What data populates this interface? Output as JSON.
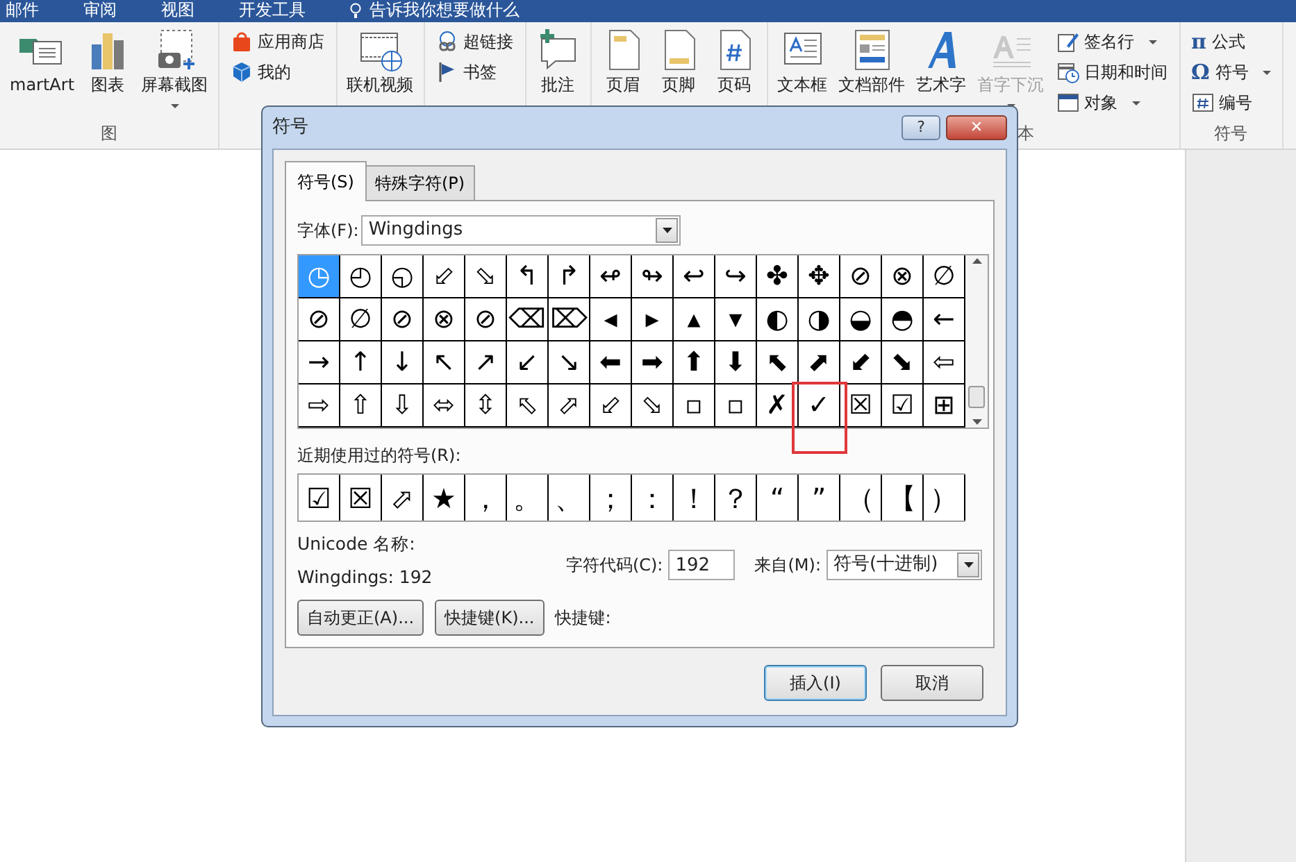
{
  "menu_tabs": [
    "邮件",
    "审阅",
    "视图",
    "开发工具"
  ],
  "tell_me": "告诉我你想要做什么",
  "ribbon": {
    "groups": [
      {
        "label": "图",
        "items": [
          {
            "label": "martArt",
            "kind": "large",
            "dropdown": false,
            "disabled": false
          },
          {
            "label": "图表",
            "kind": "large",
            "dropdown": false,
            "disabled": false
          },
          {
            "label": "屏幕截图",
            "kind": "large",
            "dropdown": true,
            "disabled": false
          }
        ]
      },
      {
        "items": [
          {
            "label": "应用商店",
            "kind": "small",
            "dropdown": false,
            "disabled": false
          },
          {
            "label": "我的",
            "kind": "small",
            "dropdown": false,
            "disabled": false
          }
        ]
      },
      {
        "items": [
          {
            "label": "联机视频",
            "kind": "large",
            "dropdown": false,
            "disabled": false
          }
        ]
      },
      {
        "items": [
          {
            "label": "超链接",
            "kind": "small",
            "dropdown": false,
            "disabled": false
          },
          {
            "label": "书签",
            "kind": "small",
            "dropdown": false,
            "disabled": false
          }
        ]
      },
      {
        "items": [
          {
            "label": "批注",
            "kind": "large",
            "dropdown": false,
            "disabled": false
          }
        ]
      },
      {
        "items": [
          {
            "label": "页眉",
            "kind": "large",
            "dropdown": false,
            "disabled": false
          },
          {
            "label": "页脚",
            "kind": "large",
            "dropdown": false,
            "disabled": false
          },
          {
            "label": "页码",
            "kind": "large",
            "dropdown": false,
            "disabled": false
          }
        ]
      },
      {
        "label": "本",
        "items": [
          {
            "label": "文本框",
            "kind": "large",
            "dropdown": false,
            "disabled": false
          },
          {
            "label": "文档部件",
            "kind": "large",
            "dropdown": false,
            "disabled": false
          },
          {
            "label": "艺术字",
            "kind": "large",
            "dropdown": false,
            "disabled": false
          },
          {
            "label": "首字下沉",
            "kind": "large",
            "dropdown": true,
            "disabled": true
          },
          {
            "label": "签名行",
            "kind": "small",
            "dropdown": true,
            "disabled": false
          },
          {
            "label": "日期和时间",
            "kind": "small",
            "dropdown": false,
            "disabled": false
          },
          {
            "label": "对象",
            "kind": "small",
            "dropdown": true,
            "disabled": false
          }
        ]
      },
      {
        "label": "符号",
        "items": [
          {
            "label": "公式",
            "kind": "small",
            "glyph": "π",
            "dropdown": false,
            "disabled": false
          },
          {
            "label": "符号",
            "kind": "small",
            "glyph": "Ω",
            "dropdown": true,
            "disabled": false
          },
          {
            "label": "编号",
            "kind": "small",
            "dropdown": false,
            "disabled": false
          }
        ]
      }
    ]
  },
  "dialog": {
    "title": "符号",
    "help_button": "?",
    "close_button": "✕",
    "tabs": [
      {
        "label": "符号(S)",
        "selected": true
      },
      {
        "label": "特殊字符(P)",
        "selected": false
      }
    ],
    "font_label": "字体(F):",
    "font_value": "Wingdings",
    "symbols": [
      {
        "glyph": "◷",
        "selected": true,
        "highlighted": false
      },
      {
        "glyph": "◴",
        "selected": false,
        "highlighted": false
      },
      {
        "glyph": "◵",
        "selected": false,
        "highlighted": false
      },
      {
        "glyph": "⬃",
        "selected": false,
        "highlighted": false
      },
      {
        "glyph": "⬂",
        "selected": false,
        "highlighted": false
      },
      {
        "glyph": "↰",
        "selected": false,
        "highlighted": false
      },
      {
        "glyph": "↱",
        "selected": false,
        "highlighted": false
      },
      {
        "glyph": "↫",
        "selected": false,
        "highlighted": false
      },
      {
        "glyph": "↬",
        "selected": false,
        "highlighted": false
      },
      {
        "glyph": "↩",
        "selected": false,
        "highlighted": false
      },
      {
        "glyph": "↪",
        "selected": false,
        "highlighted": false
      },
      {
        "glyph": "✤",
        "selected": false,
        "highlighted": false
      },
      {
        "glyph": "✥",
        "selected": false,
        "highlighted": false
      },
      {
        "glyph": "⊘",
        "selected": false,
        "highlighted": false
      },
      {
        "glyph": "⊗",
        "selected": false,
        "highlighted": false
      },
      {
        "glyph": "∅",
        "selected": false,
        "highlighted": false
      },
      {
        "glyph": "⊘",
        "selected": false,
        "highlighted": false
      },
      {
        "glyph": "∅",
        "selected": false,
        "highlighted": false
      },
      {
        "glyph": "⊘",
        "selected": false,
        "highlighted": false
      },
      {
        "glyph": "⊗",
        "selected": false,
        "highlighted": false
      },
      {
        "glyph": "⊘",
        "selected": false,
        "highlighted": false
      },
      {
        "glyph": "⌫",
        "selected": false,
        "highlighted": false
      },
      {
        "glyph": "⌦",
        "selected": false,
        "highlighted": false
      },
      {
        "glyph": "◂",
        "selected": false,
        "highlighted": false
      },
      {
        "glyph": "▸",
        "selected": false,
        "highlighted": false
      },
      {
        "glyph": "▴",
        "selected": false,
        "highlighted": false
      },
      {
        "glyph": "▾",
        "selected": false,
        "highlighted": false
      },
      {
        "glyph": "◐",
        "selected": false,
        "highlighted": false
      },
      {
        "glyph": "◑",
        "selected": false,
        "highlighted": false
      },
      {
        "glyph": "◒",
        "selected": false,
        "highlighted": false
      },
      {
        "glyph": "◓",
        "selected": false,
        "highlighted": false
      },
      {
        "glyph": "←",
        "selected": false,
        "highlighted": false
      },
      {
        "glyph": "→",
        "selected": false,
        "highlighted": false
      },
      {
        "glyph": "↑",
        "selected": false,
        "highlighted": false
      },
      {
        "glyph": "↓",
        "selected": false,
        "highlighted": false
      },
      {
        "glyph": "↖",
        "selected": false,
        "highlighted": false
      },
      {
        "glyph": "↗",
        "selected": false,
        "highlighted": false
      },
      {
        "glyph": "↙",
        "selected": false,
        "highlighted": false
      },
      {
        "glyph": "↘",
        "selected": false,
        "highlighted": false
      },
      {
        "glyph": "⬅",
        "selected": false,
        "highlighted": false
      },
      {
        "glyph": "➡",
        "selected": false,
        "highlighted": false
      },
      {
        "glyph": "⬆",
        "selected": false,
        "highlighted": false
      },
      {
        "glyph": "⬇",
        "selected": false,
        "highlighted": false
      },
      {
        "glyph": "⬉",
        "selected": false,
        "highlighted": false
      },
      {
        "glyph": "⬈",
        "selected": false,
        "highlighted": false
      },
      {
        "glyph": "⬋",
        "selected": false,
        "highlighted": false
      },
      {
        "glyph": "⬊",
        "selected": false,
        "highlighted": false
      },
      {
        "glyph": "⇦",
        "selected": false,
        "highlighted": false
      },
      {
        "glyph": "⇨",
        "selected": false,
        "highlighted": false
      },
      {
        "glyph": "⇧",
        "selected": false,
        "highlighted": false
      },
      {
        "glyph": "⇩",
        "selected": false,
        "highlighted": false
      },
      {
        "glyph": "⬄",
        "selected": false,
        "highlighted": false
      },
      {
        "glyph": "⇳",
        "selected": false,
        "highlighted": false
      },
      {
        "glyph": "⬁",
        "selected": false,
        "highlighted": false
      },
      {
        "glyph": "⬀",
        "selected": false,
        "highlighted": false
      },
      {
        "glyph": "⬃",
        "selected": false,
        "highlighted": false
      },
      {
        "glyph": "⬂",
        "selected": false,
        "highlighted": false
      },
      {
        "glyph": "▫",
        "selected": false,
        "highlighted": false
      },
      {
        "glyph": "▫",
        "selected": false,
        "highlighted": false
      },
      {
        "glyph": "✗",
        "selected": false,
        "highlighted": false
      },
      {
        "glyph": "✓",
        "selected": false,
        "highlighted": true
      },
      {
        "glyph": "☒",
        "selected": false,
        "highlighted": false
      },
      {
        "glyph": "☑",
        "selected": false,
        "highlighted": false
      },
      {
        "glyph": "⊞",
        "selected": false,
        "highlighted": false
      }
    ],
    "recent_label": "近期使用过的符号(R):",
    "recent": [
      "☑",
      "☒",
      "⬀",
      "★",
      "，",
      "。",
      "、",
      "；",
      "：",
      "！",
      "？",
      "“",
      "”",
      "（",
      "【",
      "）"
    ],
    "unicode_name_label": "Unicode 名称:",
    "unicode_name": "Wingdings: 192",
    "code_label": "字符代码(C):",
    "code_value": "192",
    "from_label": "来自(M):",
    "from_value": "符号(十进制)",
    "autocorrect_button": "自动更正(A)...",
    "shortcut_button": "快捷键(K)...",
    "shortcut_label": "快捷键:",
    "insert_button": "插入(I)",
    "cancel_button": "取消"
  }
}
